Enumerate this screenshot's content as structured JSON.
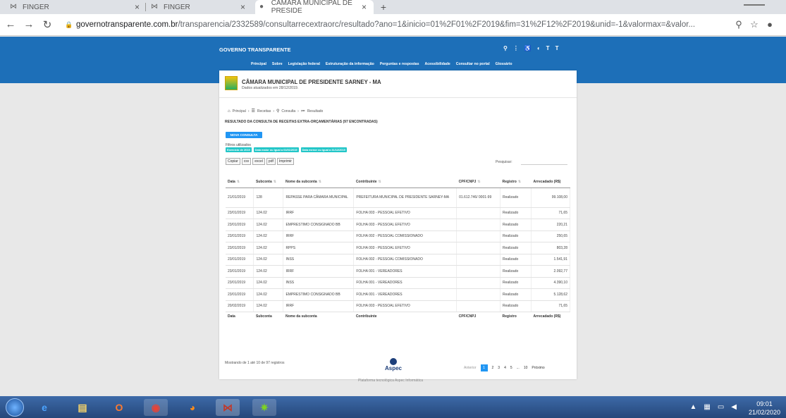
{
  "browser": {
    "tabs": [
      {
        "title": "FINGER",
        "active": false
      },
      {
        "title": "FINGER",
        "active": false
      },
      {
        "title": "CAMARA MUNICIPAL DE PRESIDE",
        "active": true
      }
    ],
    "url_host": "governotransparente.com.br",
    "url_path": "/transparencia/2332589/consultarrecextraorc/resultado?ano=1&inicio=01%2F01%2F2019&fim=31%2F12%2F2019&unid=-1&valormax=&valor..."
  },
  "site": {
    "title": "GOVERNO TRANSPARENTE",
    "nav": [
      "Principal",
      "Sobre",
      "Legislação federal",
      "Estruturação da informação",
      "Perguntas e respostas",
      "Acessibilidade",
      "Consultar no portal",
      "Glossário"
    ]
  },
  "org": {
    "name": "CÂMARA MUNICIPAL DE PRESIDENTE SARNEY - MA",
    "updated": "Dados atualizados em 28/12/2019."
  },
  "breadcrumb": [
    "Principal",
    "Receitas",
    "Consulta",
    "Resultado"
  ],
  "result_title": "RESULTADO DA CONSULTA DE RECEITAS EXTRA-ORÇAMENTÁRIAS (97 ENCONTRADAS)",
  "new_query_label": "NOVA CONSULTA",
  "filters_label": "Filtros utilizados",
  "filters": [
    "Exercício de 2019",
    "Data maior ou igual a 01/01/2019",
    "Data menor ou igual a 31/12/2019"
  ],
  "export_buttons": [
    "Copiar",
    "csv",
    "excel",
    "pdf",
    "Imprimir"
  ],
  "search_label": "Pesquisar:",
  "table": {
    "headers": [
      "Data",
      "Subconta",
      "Nome da subconta",
      "Contribuinte",
      "CPF/CNPJ",
      "Registro",
      "Arrecadado (R$)"
    ],
    "footer": [
      "Data",
      "Subconta",
      "Nome da subconta",
      "Contribuinte",
      "CPF/CNPJ",
      "Registro",
      "Arrecadado (R$)"
    ],
    "rows": [
      [
        "21/01/2019",
        "128",
        "REPASSE PARA CÂMARA MUNICIPAL",
        "PREFEITURA MUNICIPAL DE PRESIDENTE SARNEY-MA",
        "01.612.746/ 0001-99",
        "Realizado",
        "99.108,00"
      ],
      [
        "23/01/2019",
        "124.02",
        "IRRF",
        "FOLHA 003 - PESSOAL EFETIVO",
        "",
        "Realizado",
        "71,65"
      ],
      [
        "23/01/2019",
        "124.02",
        "EMPRESTIMO CONSIGNADO BB",
        "FOLHA 003 - PESSOAL EFETIVO",
        "",
        "Realizado",
        "220,21"
      ],
      [
        "23/01/2019",
        "124.02",
        "IRRF",
        "FOLHA 002 - PESSOAL COMISSIONADO",
        "",
        "Realizado",
        "250,65"
      ],
      [
        "23/01/2019",
        "124.02",
        "RPPS",
        "FOLHA 003 - PESSOAL EFETIVO",
        "",
        "Realizado",
        "803,28"
      ],
      [
        "23/01/2019",
        "124.02",
        "INSS",
        "FOLHA 002 - PESSOAL COMISSIONADO",
        "",
        "Realizado",
        "1.541,91"
      ],
      [
        "23/01/2019",
        "124.02",
        "IRRF",
        "FOLHA 001 - VEREADORES",
        "",
        "Realizado",
        "2.092,77"
      ],
      [
        "23/01/2019",
        "124.02",
        "INSS",
        "FOLHA 001 - VEREADORES",
        "",
        "Realizado",
        "4.390,10"
      ],
      [
        "23/01/2019",
        "124.02",
        "EMPRESTIMO CONSIGNADO BB",
        "FOLHA 001 - VEREADORES",
        "",
        "Realizado",
        "5.128,62"
      ],
      [
        "20/02/2019",
        "124.02",
        "IRRF",
        "FOLHA 003 - PESSOAL EFETIVO",
        "",
        "Realizado",
        "71,65"
      ]
    ]
  },
  "showing": "Mostrando de 1 até 10 de 97 registros",
  "pager": {
    "prev": "Anterior",
    "pages": [
      "1",
      "2",
      "3",
      "4",
      "5",
      "...",
      "10"
    ],
    "next": "Próximo"
  },
  "footer": {
    "brand": "Aspec",
    "text": "Plataforma tecnológica Aspec Informática"
  },
  "clock": {
    "time": "09:01",
    "date": "21/02/2020"
  },
  "colors": {
    "header_blue": "#1d6fb8",
    "accent": "#2196f3",
    "filter": "#23c6c8"
  }
}
